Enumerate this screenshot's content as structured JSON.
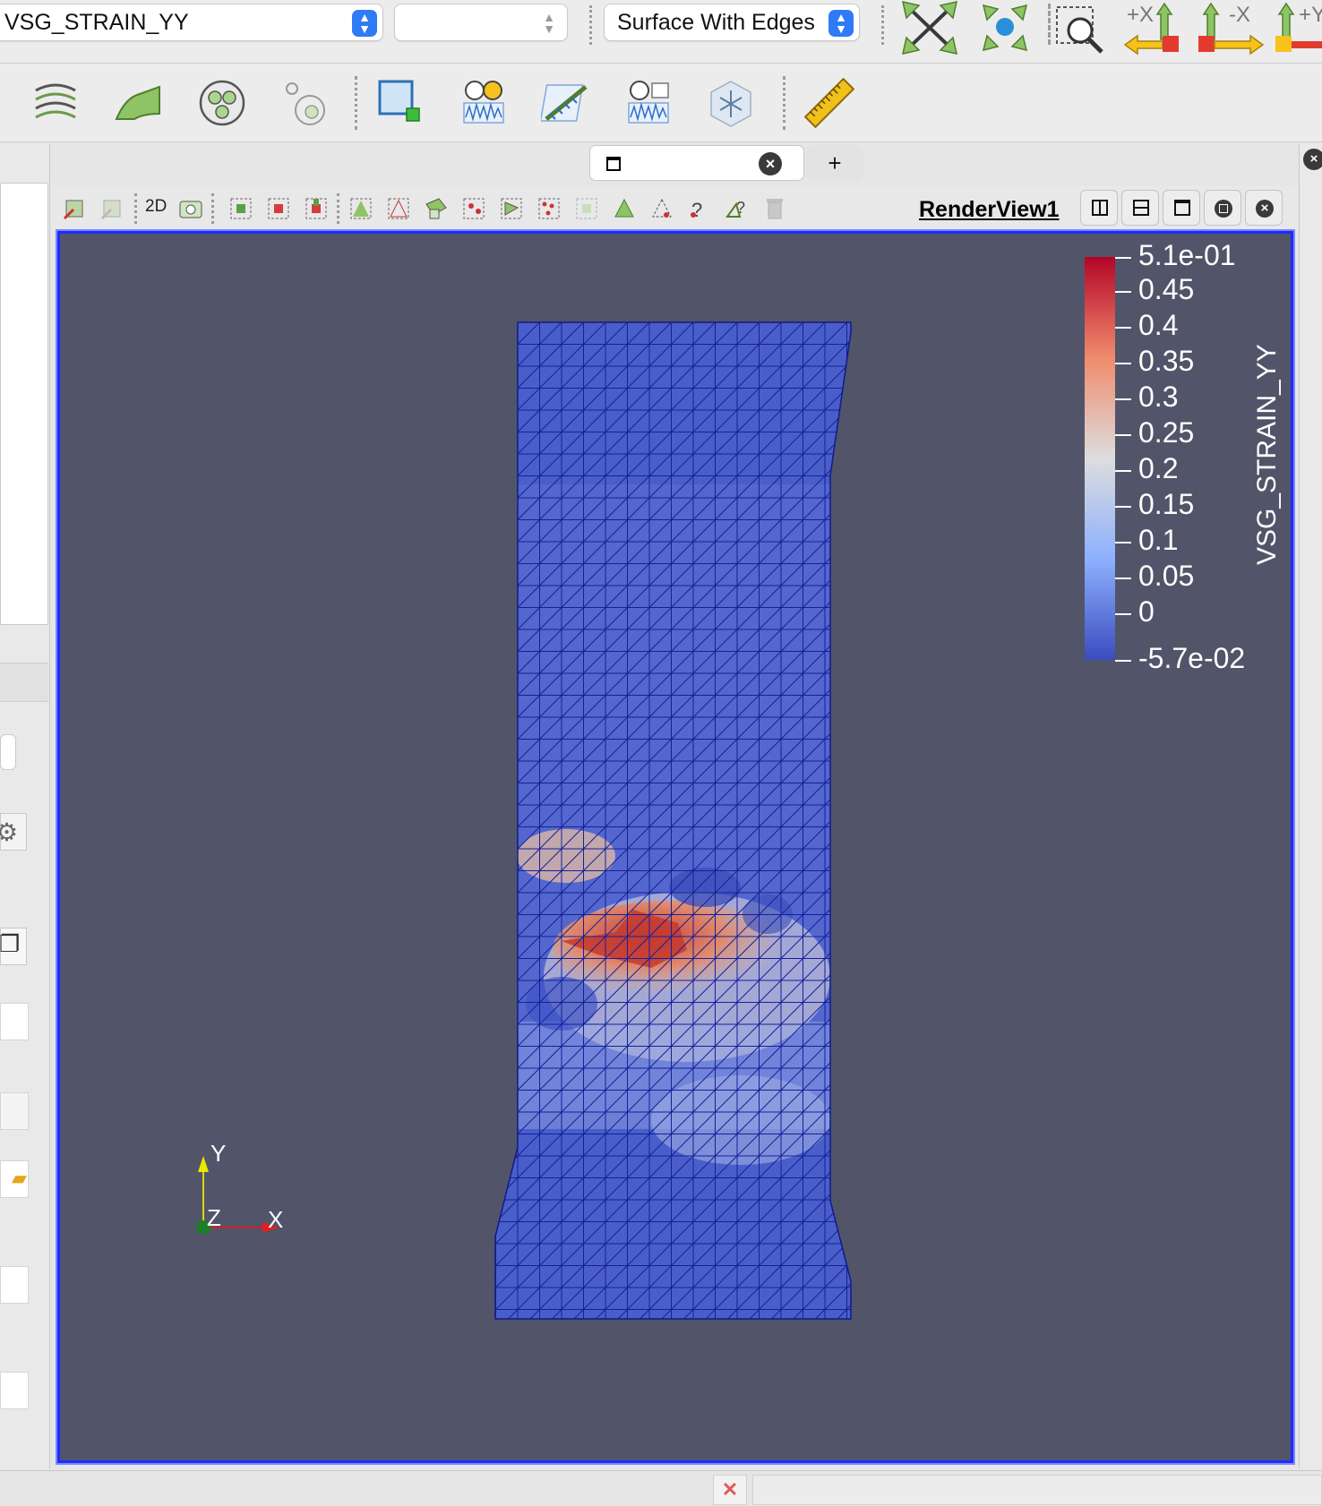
{
  "toolbar": {
    "array_select_value": "VSG_STRAIN_YY",
    "component_select_value": "",
    "representation_select_value": "Surface With Edges",
    "camera_buttons": [
      {
        "icon": "reset-camera-icon"
      },
      {
        "icon": "zoom-to-data-icon"
      },
      {
        "icon": "zoom-to-box-icon"
      },
      {
        "icon": "view-plus-x-icon",
        "label": "+X"
      },
      {
        "icon": "view-minus-x-icon",
        "label": "-X"
      },
      {
        "icon": "view-plus-y-icon",
        "label": "+Y"
      }
    ],
    "filter_buttons": [
      {
        "icon": "contour-icon"
      },
      {
        "icon": "slice-icon"
      },
      {
        "icon": "glyph-icon"
      },
      {
        "icon": "clip-icon"
      },
      {
        "icon": "extract-selection-icon"
      },
      {
        "icon": "plot-over-time-icon"
      },
      {
        "icon": "stream-tracer-icon"
      },
      {
        "icon": "plot-data-icon"
      },
      {
        "icon": "spreadsheet-icon"
      },
      {
        "icon": "ruler-icon"
      }
    ]
  },
  "tabs": {
    "add_label": "+"
  },
  "viewbar": {
    "label_2d": "2D",
    "render_view_label": "RenderView1"
  },
  "legend": {
    "title": "VSG_STRAIN_YY",
    "ticks": [
      "5.1e-01",
      "0.45",
      "0.4",
      "0.35",
      "0.3",
      "0.25",
      "0.2",
      "0.15",
      "0.1",
      "0.05",
      "0",
      "-5.7e-02"
    ],
    "color_max": "#b40426",
    "color_mid": "#dddddd",
    "color_min": "#3b4cc0"
  },
  "orientation_axes": {
    "x_label": "X",
    "y_label": "Y",
    "z_label": "Z"
  },
  "colors": {
    "background": "#525469",
    "accent_blue": "#2f7bf5",
    "selection_border": "#1d2cff"
  }
}
